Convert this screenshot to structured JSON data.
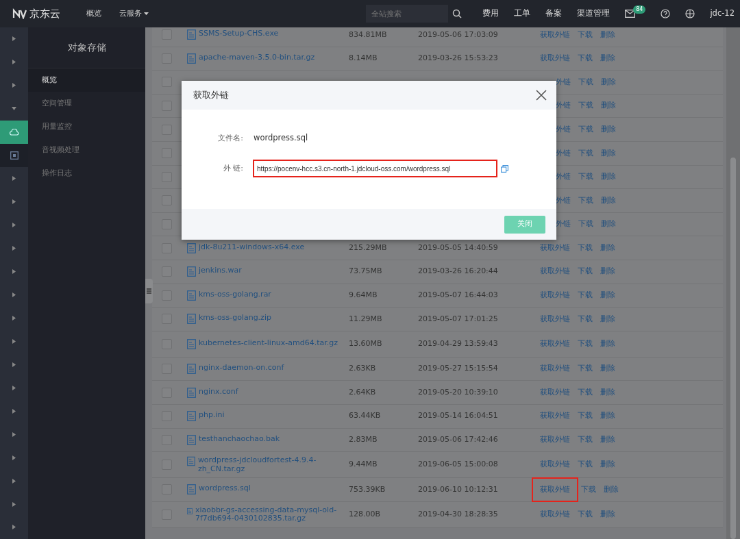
{
  "topbar": {
    "logo": "京东云",
    "nav": [
      {
        "label": "概览",
        "dropdown": false
      },
      {
        "label": "云服务",
        "dropdown": true
      }
    ],
    "search": {
      "placeholder": "全站搜索"
    },
    "links": [
      "费用",
      "工单",
      "备案",
      "渠道管理"
    ],
    "mail_badge": "84",
    "user": "jdc-12"
  },
  "rail": [
    {
      "kind": "chevron"
    },
    {
      "kind": "chevron"
    },
    {
      "kind": "chevron"
    },
    {
      "kind": "chevron-down"
    },
    {
      "kind": "cloud",
      "selected": true
    },
    {
      "kind": "box",
      "selected": false
    },
    {
      "kind": "chevron"
    },
    {
      "kind": "chevron"
    },
    {
      "kind": "chevron"
    },
    {
      "kind": "chevron"
    },
    {
      "kind": "chevron"
    },
    {
      "kind": "chevron"
    },
    {
      "kind": "chevron"
    },
    {
      "kind": "chevron"
    },
    {
      "kind": "chevron"
    },
    {
      "kind": "chevron"
    },
    {
      "kind": "chevron"
    },
    {
      "kind": "chevron"
    },
    {
      "kind": "chevron"
    },
    {
      "kind": "chevron"
    },
    {
      "kind": "chevron"
    },
    {
      "kind": "chevron"
    }
  ],
  "sidebar": {
    "title": "对象存储",
    "items": [
      {
        "label": "概览",
        "selected": true
      },
      {
        "label": "空间管理",
        "selected": false
      },
      {
        "label": "用量监控",
        "selected": false
      },
      {
        "label": "音视频处理",
        "selected": false
      },
      {
        "label": "操作日志",
        "selected": false
      }
    ]
  },
  "table": {
    "rows": [
      {
        "kind": "file",
        "checked": false,
        "name": "SSMS-Setup-CHS.exe",
        "size": "834.81MB",
        "date": "2019-05-06 17:03:09",
        "actions": [
          "获取外链",
          "下载",
          "删除"
        ]
      },
      {
        "kind": "file",
        "checked": false,
        "name": "apache-maven-3.5.0-bin.tar.gz",
        "size": "8.14MB",
        "date": "2019-03-26 15:53:23",
        "actions": [
          "获取外链",
          "下载",
          "删除"
        ]
      },
      {
        "kind": "covered",
        "checked": false,
        "actions": [
          "外链",
          "下载",
          "删除"
        ]
      },
      {
        "kind": "covered",
        "checked": false,
        "actions": [
          "外链",
          "下载",
          "删除"
        ]
      },
      {
        "kind": "covered",
        "checked": false,
        "actions": [
          "外链",
          "下载",
          "删除"
        ]
      },
      {
        "kind": "covered",
        "checked": false,
        "actions": [
          "外链",
          "下载",
          "删除"
        ]
      },
      {
        "kind": "covered",
        "checked": false,
        "actions": [
          "外链",
          "下载",
          "删除"
        ]
      },
      {
        "kind": "covered",
        "checked": false,
        "actions": [
          "外链",
          "下载",
          "删除"
        ]
      },
      {
        "kind": "covered",
        "checked": false,
        "actions": [
          "外链",
          "下载",
          "删除"
        ]
      },
      {
        "kind": "file",
        "checked": false,
        "name": "jdk-8u211-windows-x64.exe",
        "size": "215.29MB",
        "date": "2019-05-05 14:40:59",
        "actions": [
          "获取外链",
          "下载",
          "删除"
        ]
      },
      {
        "kind": "file",
        "checked": false,
        "name": "jenkins.war",
        "size": "73.75MB",
        "date": "2019-03-26 16:20:44",
        "actions": [
          "获取外链",
          "下载",
          "删除"
        ]
      },
      {
        "kind": "file",
        "checked": false,
        "name": "kms-oss-golang.rar",
        "size": "9.64MB",
        "date": "2019-05-07 16:44:03",
        "actions": [
          "获取外链",
          "下载",
          "删除"
        ]
      },
      {
        "kind": "file",
        "checked": false,
        "name": "kms-oss-golang.zip",
        "size": "11.29MB",
        "date": "2019-05-07 17:01:25",
        "actions": [
          "获取外链",
          "下载",
          "删除"
        ]
      },
      {
        "kind": "file",
        "checked": false,
        "name": "kubernetes-client-linux-amd64.tar.gz",
        "size": "13.60MB",
        "date": "2019-04-29 13:59:43",
        "actions": [
          "获取外链",
          "下载",
          "删除"
        ]
      },
      {
        "kind": "file",
        "checked": false,
        "name": "nginx-daemon-on.conf",
        "size": "2.63KB",
        "date": "2019-05-27 15:15:54",
        "actions": [
          "获取外链",
          "下载",
          "删除"
        ]
      },
      {
        "kind": "file",
        "checked": false,
        "name": "nginx.conf",
        "size": "2.64KB",
        "date": "2019-05-20 10:39:10",
        "actions": [
          "获取外链",
          "下载",
          "删除"
        ]
      },
      {
        "kind": "file",
        "checked": false,
        "name": "php.ini",
        "size": "63.44KB",
        "date": "2019-05-14 16:04:51",
        "actions": [
          "获取外链",
          "下载",
          "删除"
        ]
      },
      {
        "kind": "file",
        "checked": false,
        "name": "testhanchaochao.bak",
        "size": "2.83MB",
        "date": "2019-05-06 17:42:46",
        "actions": [
          "获取外链",
          "下载",
          "删除"
        ]
      },
      {
        "kind": "file",
        "checked": false,
        "name": "wordpress-jdcloudfortest-4.9.4-zh_CN.tar.gz",
        "size": "9.44MB",
        "date": "2019-06-05 15:00:08",
        "actions": [
          "获取外链",
          "下载",
          "删除"
        ]
      },
      {
        "kind": "file",
        "checked": false,
        "name": "wordpress.sql",
        "size": "753.39KB",
        "date": "2019-06-10 10:12:31",
        "actions": [
          "获取外链",
          "下载",
          "删除"
        ],
        "highlighted": true
      },
      {
        "kind": "file",
        "checked": false,
        "name": "xiaobbr-gs-accessing-data-mysql-old-7f7db694-0430102835.tar.gz",
        "size": "128.00B",
        "date": "2019-04-30 18:28:35",
        "actions": [
          "获取外链",
          "下载",
          "删除"
        ]
      }
    ]
  },
  "modal": {
    "title": "获取外链",
    "fields": [
      {
        "label": "文件名:",
        "kind": "text",
        "value": "wordpress.sql"
      },
      {
        "label": "外 链:",
        "kind": "input",
        "value": "https://pocenv-hcc.s3.cn-north-1.jdcloud-oss.com/wordpress.sql",
        "highlighted": true
      }
    ],
    "button": "关闭"
  }
}
